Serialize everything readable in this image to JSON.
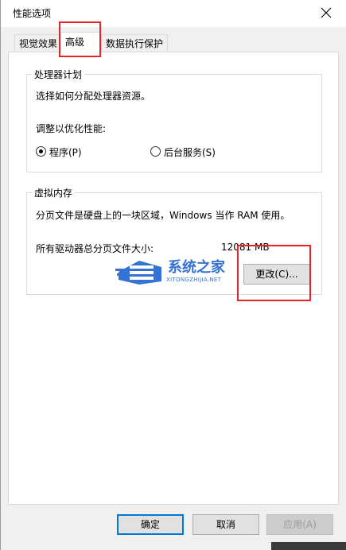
{
  "window": {
    "title": "性能选项"
  },
  "tabs": [
    {
      "label": "视觉效果",
      "active": false
    },
    {
      "label": "高级",
      "active": true
    },
    {
      "label": "数据执行保护",
      "active": false
    }
  ],
  "processor": {
    "group_title": "处理器计划",
    "description": "选择如何分配处理器资源。",
    "adjust_label": "调整以优化性能:",
    "option_programs": "程序(P)",
    "option_background": "后台服务(S)",
    "selected": "programs"
  },
  "virtual_memory": {
    "group_title": "虚拟内存",
    "description": "分页文件是硬盘上的一块区域，Windows 当作 RAM 使用。",
    "total_label": "所有驱动器总分页文件大小:",
    "total_value": "12081 MB",
    "change_button": "更改(C)..."
  },
  "footer": {
    "ok": "确定",
    "cancel": "取消",
    "apply": "应用(A)"
  },
  "watermark": {
    "brand": "系统之家",
    "domain": "XITONGZHIJIA.NET"
  },
  "colors": {
    "highlight_box": "#e8242b",
    "focus_border": "#0078d7"
  }
}
